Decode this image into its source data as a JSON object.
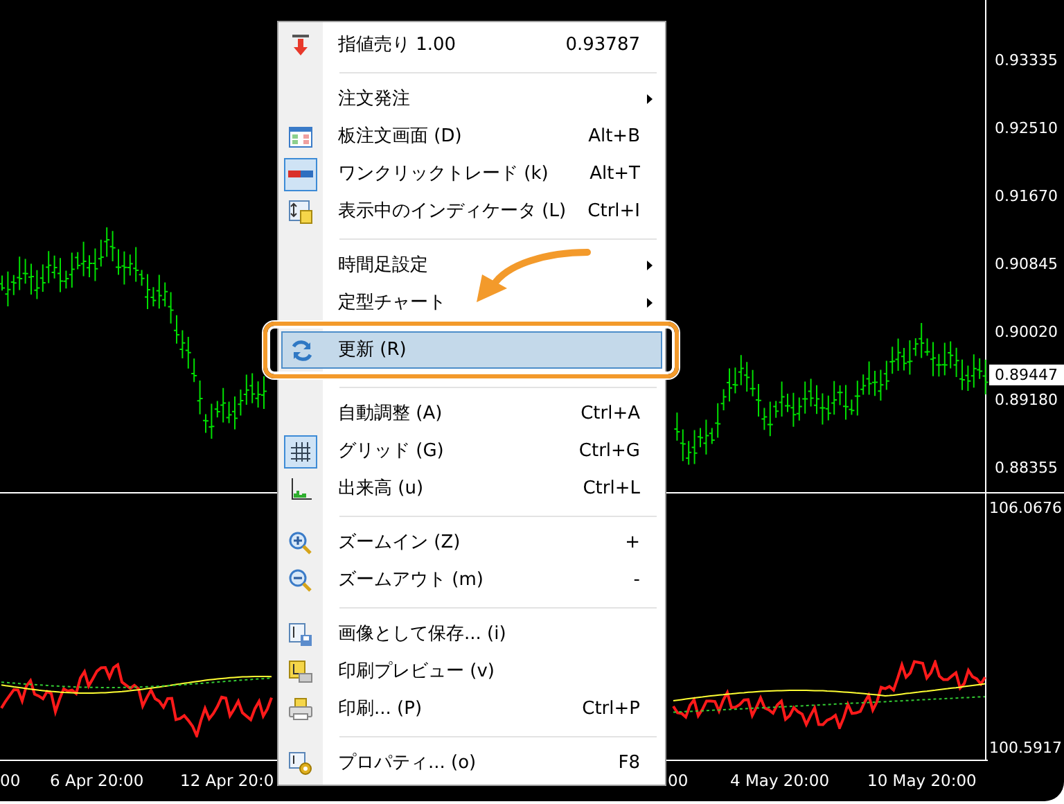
{
  "price_axis": {
    "labels": [
      "0.93335",
      "0.92510",
      "0.91670",
      "0.90845",
      "0.90020",
      "0.89180",
      "0.88355"
    ],
    "current_price": "0.89447"
  },
  "indicator_axis": {
    "labels": [
      "106.0676",
      "100.5917"
    ]
  },
  "time_axis": {
    "labels": [
      "00",
      "6 Apr 20:00",
      "12 Apr 20:0",
      "00",
      "4 May 20:00",
      "10 May 20:00"
    ]
  },
  "context_menu": {
    "items": [
      {
        "kind": "item",
        "label": "指値売り 1.00",
        "shortcut": "0.93787",
        "checked": false,
        "selected": false
      },
      {
        "kind": "separator"
      },
      {
        "kind": "submenu",
        "label": "注文発注",
        "selected": false
      },
      {
        "kind": "item",
        "label": "板注文画面 (D)",
        "shortcut": "Alt+B",
        "checked": false,
        "selected": false
      },
      {
        "kind": "item",
        "label": "ワンクリックトレード (k)",
        "shortcut": "Alt+T",
        "checked": true,
        "selected": false
      },
      {
        "kind": "item",
        "label": "表示中のインディケータ (L)",
        "shortcut": "Ctrl+I",
        "checked": false,
        "selected": false
      },
      {
        "kind": "separator"
      },
      {
        "kind": "submenu",
        "label": "時間足設定",
        "selected": false
      },
      {
        "kind": "submenu",
        "label": "定型チャート",
        "selected": false
      },
      {
        "kind": "item",
        "label": "更新 (R)",
        "checked": false,
        "selected": true
      },
      {
        "kind": "separator"
      },
      {
        "kind": "item",
        "label": "自動調整 (A)",
        "shortcut": "Ctrl+A",
        "checked": false,
        "selected": false
      },
      {
        "kind": "item",
        "label": "グリッド (G)",
        "shortcut": "Ctrl+G",
        "checked": true,
        "selected": false
      },
      {
        "kind": "item",
        "label": "出来高 (u)",
        "shortcut": "Ctrl+L",
        "checked": false,
        "selected": false
      },
      {
        "kind": "separator"
      },
      {
        "kind": "item",
        "label": "ズームイン (Z)",
        "shortcut": "+",
        "checked": false,
        "selected": false
      },
      {
        "kind": "item",
        "label": "ズームアウト (m)",
        "shortcut": "-",
        "checked": false,
        "selected": false
      },
      {
        "kind": "separator"
      },
      {
        "kind": "item",
        "label": "画像として保存... (i)",
        "checked": false,
        "selected": false
      },
      {
        "kind": "item",
        "label": "印刷プレビュー (v)",
        "checked": false,
        "selected": false
      },
      {
        "kind": "item",
        "label": "印刷... (P)",
        "shortcut": "Ctrl+P",
        "checked": false,
        "selected": false
      },
      {
        "kind": "separator"
      },
      {
        "kind": "item",
        "label": "プロパティ... (o)",
        "shortcut": "F8",
        "checked": false,
        "selected": false
      }
    ]
  }
}
